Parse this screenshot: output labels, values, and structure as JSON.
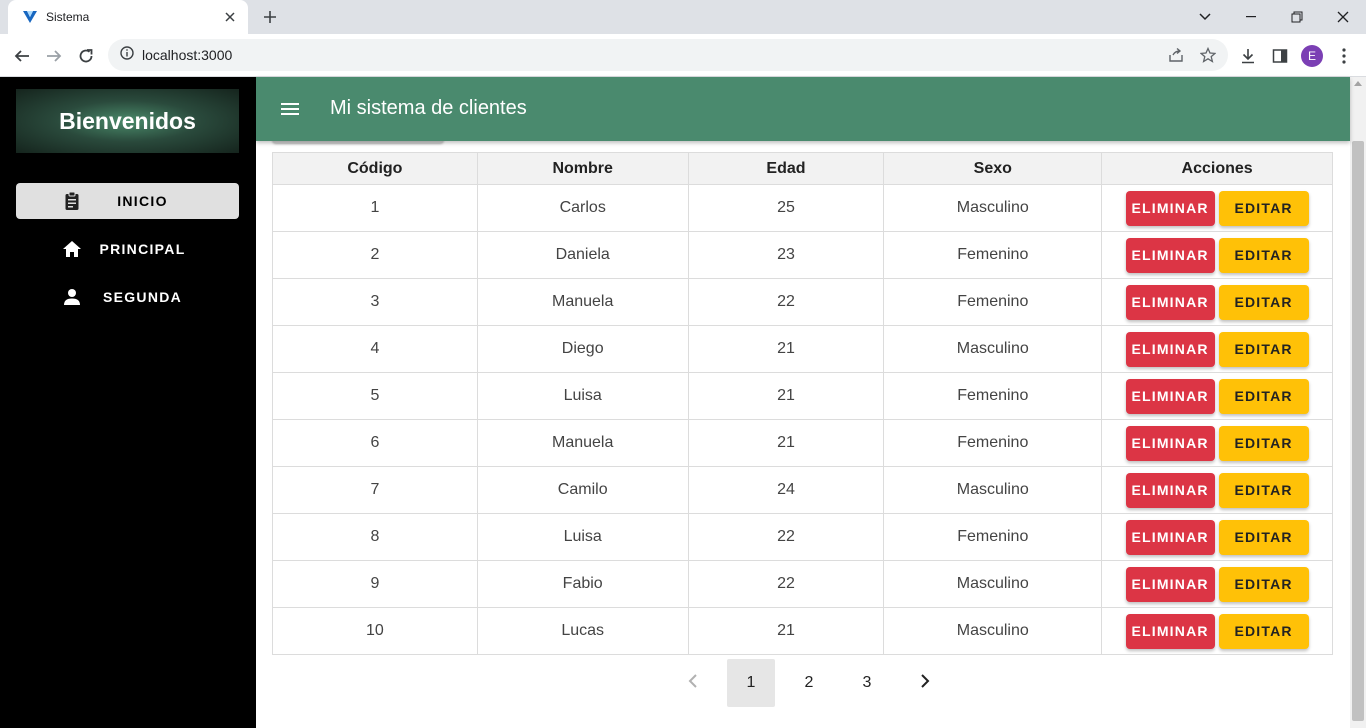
{
  "browser": {
    "tab_title": "Sistema",
    "url": "localhost:3000",
    "profile_initial": "E"
  },
  "sidebar": {
    "brand": "Bienvenidos",
    "items": [
      {
        "label": "INICIO",
        "icon": "clipboard-icon",
        "active": true
      },
      {
        "label": "PRINCIPAL",
        "icon": "home-icon",
        "active": false
      },
      {
        "label": "SEGUNDA",
        "icon": "person-icon",
        "active": false
      }
    ]
  },
  "appbar": {
    "title": "Mi sistema de clientes"
  },
  "table": {
    "headers": [
      "Código",
      "Nombre",
      "Edad",
      "Sexo",
      "Acciones"
    ],
    "rows": [
      {
        "codigo": "1",
        "nombre": "Carlos",
        "edad": "25",
        "sexo": "Masculino"
      },
      {
        "codigo": "2",
        "nombre": "Daniela",
        "edad": "23",
        "sexo": "Femenino"
      },
      {
        "codigo": "3",
        "nombre": "Manuela",
        "edad": "22",
        "sexo": "Femenino"
      },
      {
        "codigo": "4",
        "nombre": "Diego",
        "edad": "21",
        "sexo": "Masculino"
      },
      {
        "codigo": "5",
        "nombre": "Luisa",
        "edad": "21",
        "sexo": "Femenino"
      },
      {
        "codigo": "6",
        "nombre": "Manuela",
        "edad": "21",
        "sexo": "Femenino"
      },
      {
        "codigo": "7",
        "nombre": "Camilo",
        "edad": "24",
        "sexo": "Masculino"
      },
      {
        "codigo": "8",
        "nombre": "Luisa",
        "edad": "22",
        "sexo": "Femenino"
      },
      {
        "codigo": "9",
        "nombre": "Fabio",
        "edad": "22",
        "sexo": "Masculino"
      },
      {
        "codigo": "10",
        "nombre": "Lucas",
        "edad": "21",
        "sexo": "Masculino"
      }
    ],
    "delete_label": "ELIMINAR",
    "edit_label": "EDITAR"
  },
  "pagination": {
    "pages": [
      "1",
      "2",
      "3"
    ],
    "current": "1"
  },
  "colors": {
    "appbar": "#4a8a6e",
    "delete": "#dc3545",
    "edit": "#ffc107"
  }
}
